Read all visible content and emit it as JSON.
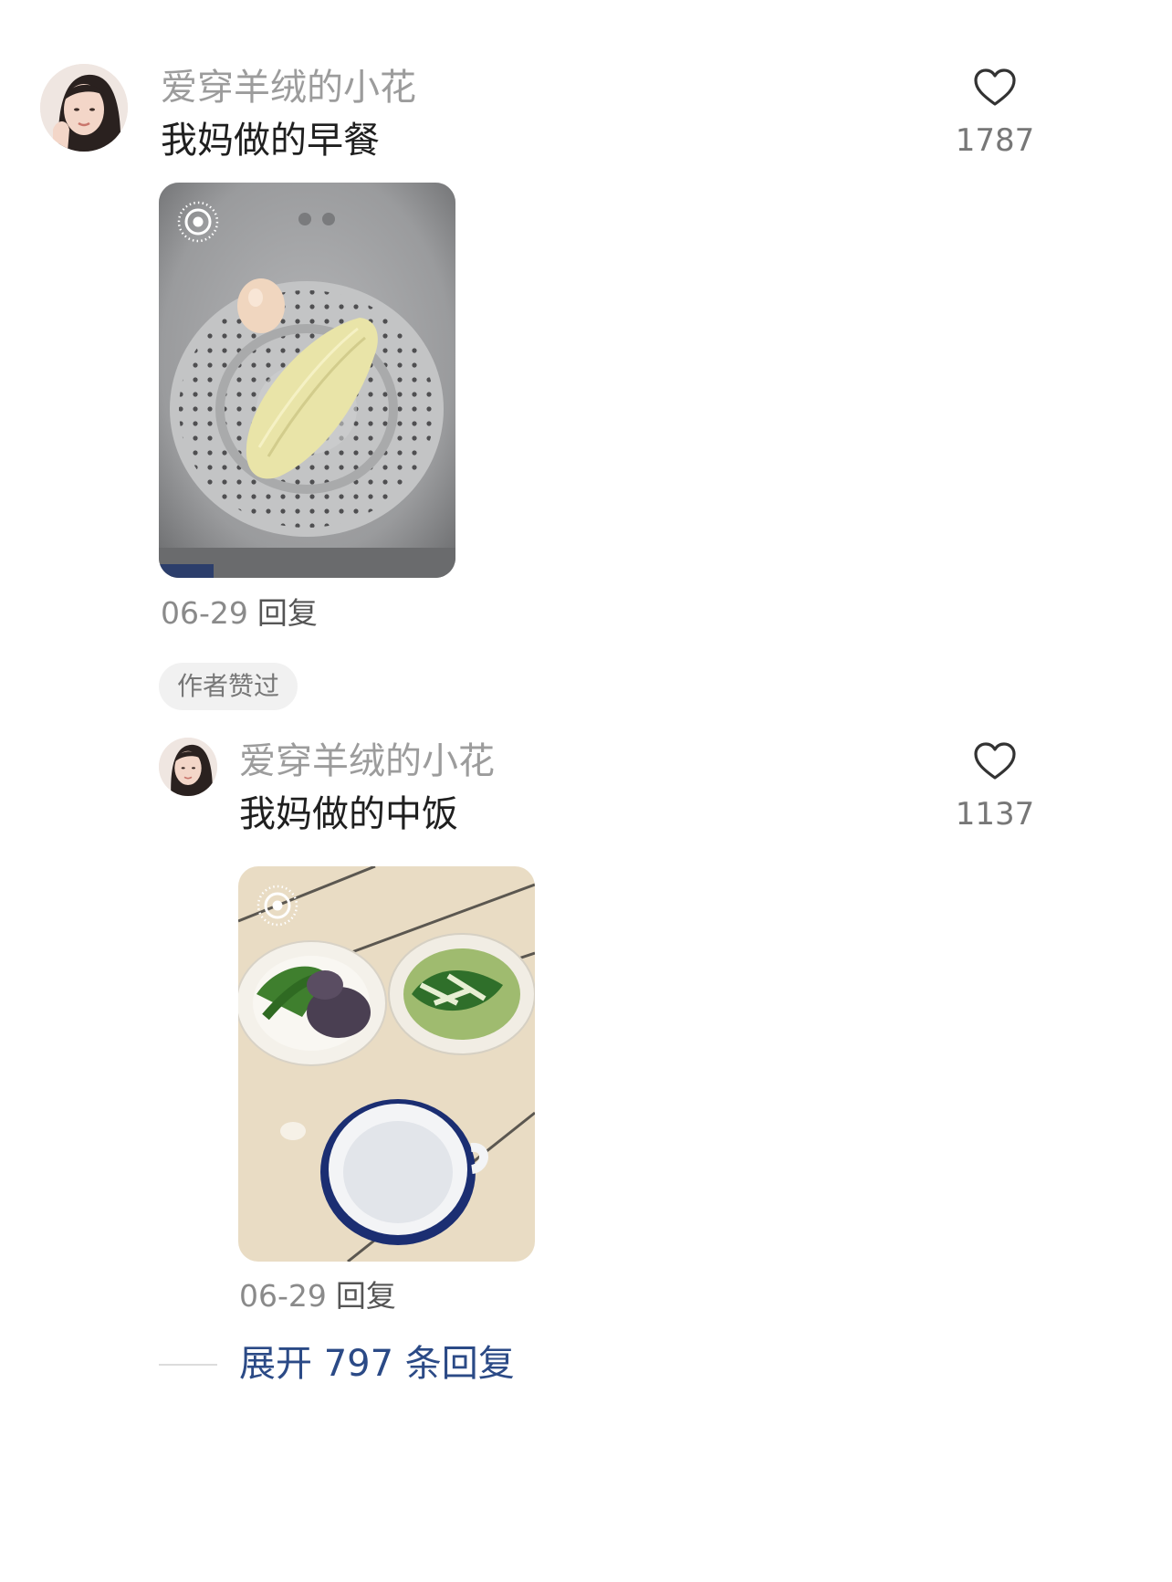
{
  "comments": [
    {
      "username": "爱穿羊绒的小花",
      "text": "我妈做的早餐",
      "likes": "1787",
      "date": "06-29",
      "reply_label": "回复",
      "photo_icon": "live-photo-icon",
      "photo_subject": "steamer-with-egg-and-corn"
    },
    {
      "username": "爱穿羊绒的小花",
      "text": "我妈做的中饭",
      "likes": "1137",
      "date": "06-29",
      "reply_label": "回复",
      "photo_icon": "live-photo-icon",
      "photo_subject": "table-with-dishes-and-mug"
    }
  ],
  "author_liked_badge": "作者赞过",
  "expand_replies": "展开 797 条回复",
  "colors": {
    "username": "#9c9c9c",
    "expand_link": "#2b4a86",
    "badge_bg": "#f1f1f1"
  },
  "icons": {
    "like": "heart-outline-icon"
  }
}
